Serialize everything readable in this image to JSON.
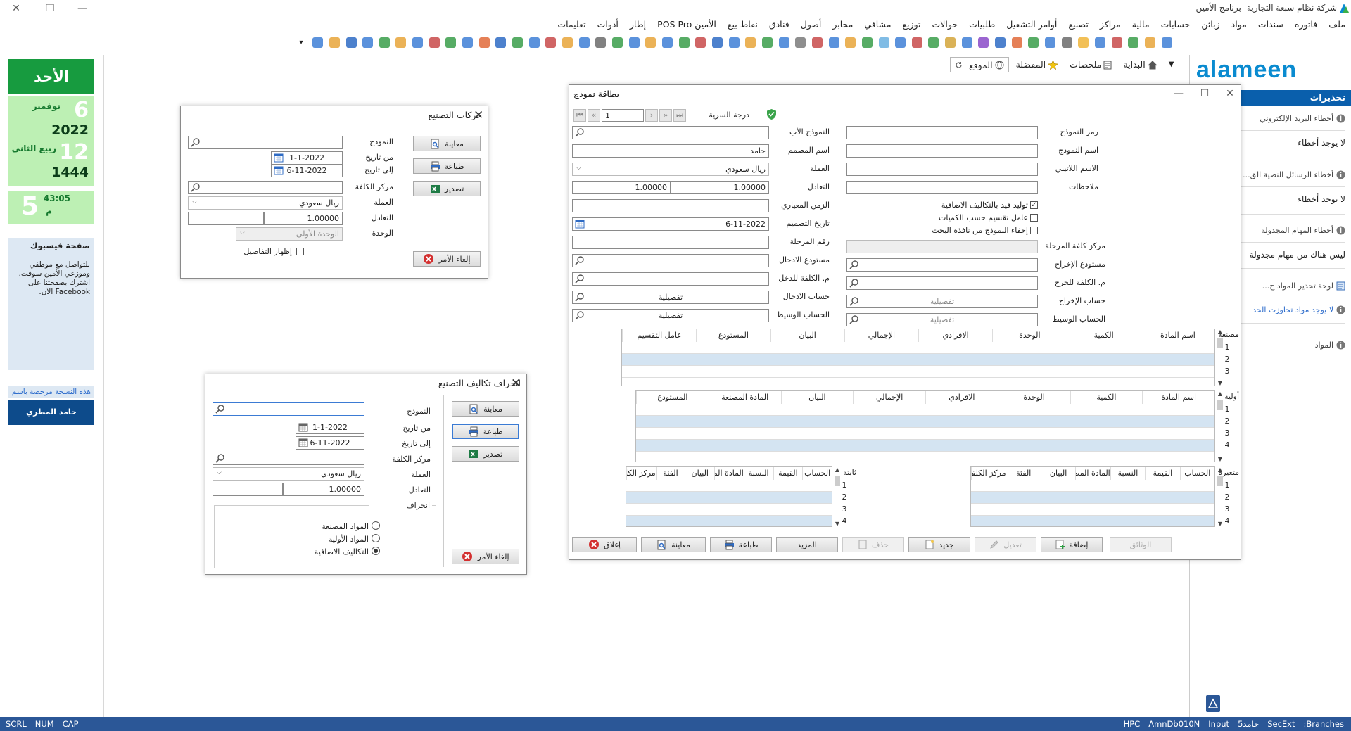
{
  "app": {
    "title": "شركة نظام سبعة التجارية -برنامج الأمين",
    "brand": "alameen"
  },
  "menu": [
    "ملف",
    "فاتورة",
    "سندات",
    "مواد",
    "زبائن",
    "حسابات",
    "مالية",
    "مراكز",
    "تصنيع",
    "أوامر التشغيل",
    "طلبيات",
    "حوالات",
    "توزيع",
    "مشافي",
    "مخابر",
    "أصول",
    "فنادق",
    "نقاط بيع",
    "الأمين POS Pro",
    "إطار",
    "أدوات",
    "تعليمات"
  ],
  "toolbar_icon_colors": [
    "#3e7fd6",
    "#e8a43a",
    "#3a9e4a",
    "#c84a4a",
    "#3e7fd6",
    "#f0b53a",
    "#6b6b6b",
    "#3e7fd6",
    "#3a9e4a",
    "#e06a3a",
    "#2e6bc4",
    "#8a4ac8",
    "#3e7fd6",
    "#d4a43a",
    "#3a9e4a",
    "#c84a4a",
    "#3e7fd6",
    "#6ab0e0",
    "#3a9e4a",
    "#e8a43a",
    "#3e7fd6",
    "#c84a4a",
    "#7a7a7a",
    "#3e7fd6",
    "#3a9e4a",
    "#e8a43a",
    "#3e7fd6",
    "#2e6bc4",
    "#c84a4a",
    "#3a9e4a",
    "#3e7fd6",
    "#e8a43a",
    "#3e7fd6",
    "#3a9e4a",
    "#6b6b6b",
    "#3e7fd6",
    "#e8a43a",
    "#c84a4a",
    "#3e7fd6",
    "#3a9e4a",
    "#2e6bc4",
    "#e06a3a",
    "#3e7fd6",
    "#3a9e4a",
    "#c84a4a",
    "#3e7fd6",
    "#e8a43a",
    "#3a9e4a",
    "#3e7fd6",
    "#2e6bc4",
    "#e8a43a",
    "#3e7fd6"
  ],
  "tabs": {
    "home": "البداية",
    "notes": "ملحصات",
    "fav": "المفضلة",
    "site": "الموقع"
  },
  "calendar": {
    "dayname": "الأحد",
    "day": "6",
    "month": "نوفمبر",
    "year": "2022",
    "hday": "12",
    "hmonth": "ربيع الثاني",
    "hyear": "1444",
    "time": "43:05",
    "hour": "5",
    "ampm": "م"
  },
  "facebook": {
    "title": "صفحة فيسبوك",
    "body": "للتواصل مع موظفي وموزعي الأمين سوفت، اشترك بصفحتنا على Facebook الآن."
  },
  "license": {
    "label": "هذه النسخة مرخصة باسم",
    "owner": "حامد المطري"
  },
  "alerts": {
    "title": "تحذيرات",
    "email_title": "أخطاء البريد الإلكتروني",
    "email_val": "لا يوجد أخطاء",
    "sms_title": "أخطاء الرسائل النصية الق...",
    "sms_val": "لا يوجد أخطاء",
    "tasks_title": "أخطاء المهام المجدولة",
    "tasks_val": "ليس هناك من مهام مجدولة",
    "stock_title": "لوحة تحذير المواد ح...",
    "stock_val": "لا يوجد مواد تجاوزت الحد",
    "items_title": "المواد"
  },
  "w1": {
    "title": "حركات التصنيع",
    "model": "النموذج",
    "from": "من تاريخ",
    "from_val": "1-1-2022",
    "to": "إلى تاريخ",
    "to_val": "6-11-2022",
    "cc": "مركز الكلفة",
    "cur": "العملة",
    "cur_val": "ريال سعودي",
    "rate": "التعادل",
    "rate_val": "1.00000",
    "unit": "الوحدة",
    "unit_val": "الوحدة الأولى",
    "details": "إظهار التفاصيل",
    "preview": "معاينة",
    "print": "طباعة",
    "export": "تصدير",
    "cancel": "إلغاء الأمر"
  },
  "w2": {
    "title": "انحراف تكاليف التصنيع",
    "model": "النموذج",
    "from": "من تاريخ",
    "from_val": "1-1-2022",
    "to": "إلى تاريخ",
    "to_val": "6-11-2022",
    "cc": "مركز الكلفة",
    "cur": "العملة",
    "cur_val": "ريال سعودي",
    "rate": "التعادل",
    "rate_val": "1.00000",
    "dev": "انحراف",
    "opt1": "المواد المصنعة",
    "opt2": "المواد الأولية",
    "opt3": "التكاليف الاضافية",
    "preview": "معاينة",
    "print": "طباعة",
    "export": "تصدير",
    "cancel": "إلغاء الأمر"
  },
  "w3": {
    "title": "بطاقة نموذج",
    "page": "1",
    "secrecy": "درجة السرية",
    "code": "رمز النموذج",
    "name": "اسم النموذج",
    "latin": "الاسم اللاتيني",
    "notes": "ملاحظات",
    "parent": "النموذج الأب",
    "designer": "اسم المصمم",
    "designer_val": "حامد",
    "cur": "العملة",
    "cur_val": "ريال سعودي",
    "rate": "التعادل",
    "rate_val1": "1.00000",
    "rate_val2": "1.00000",
    "stdtime": "الزمن المعياري",
    "ddate": "تاريخ التصميم",
    "ddate_val": "6-11-2022",
    "stage": "رقم المرحلة",
    "chk1": "توليد قيد بالتكاليف الاضافية",
    "chk2": "عامل تقسيم حسب الكميات",
    "chk3": "إخفاء النموذج من نافذة البحث",
    "stagecc": "مركز كلفة المرحلة",
    "inwh": "مستودع الادخال",
    "outwh": "مستودع الإخراج",
    "incc": "م. الكلفة للدخل",
    "outcc": "م. الكلفة للخرج",
    "inacc": "حساب الادخال",
    "outacc": "حساب الإخراج",
    "mid1": "الحساب الوسيط",
    "mid2": "الحساب الوسيط",
    "detail": "تفصيلية",
    "g1": {
      "side": "مصنعة",
      "cols": [
        "اسم المادة",
        "الكمية",
        "الوحدة",
        "الافرادي",
        "الإجمالي",
        "البيان",
        "المستودع",
        "عامل التقسيم"
      ]
    },
    "g2": {
      "side": "أولية",
      "cols": [
        "اسم المادة",
        "الكمية",
        "الوحدة",
        "الافرادي",
        "الإجمالي",
        "البيان",
        "المادة المصنعة",
        "المستودع"
      ]
    },
    "g3": {
      "side": "متغيرة",
      "cols": [
        "الحساب",
        "القيمة",
        "النسبة",
        "المادة المصنعة",
        "البيان",
        "الفئة",
        "مركز الكلفة"
      ]
    },
    "g4": {
      "side": "ثابتة",
      "cols": [
        "الحساب",
        "القيمة",
        "النسبة",
        "المادة المصنعة",
        "البيان",
        "الفئة",
        "مركز الكلفة"
      ]
    },
    "rows": [
      "1",
      "2",
      "3",
      "4"
    ],
    "b_docs": "الوثائق",
    "b_add": "إضافة",
    "b_edit": "تعديل",
    "b_new": "جديد",
    "b_del": "حذف",
    "b_more": "المزيد",
    "b_print": "طباعة",
    "b_preview": "معاينة",
    "b_close": "إغلاق"
  },
  "status": {
    "left": [
      "SCRL",
      "NUM",
      "CAP"
    ],
    "right": [
      "HPC",
      "AmnDb010N",
      "Input",
      "5حامد",
      "SecExt",
      ":Branches"
    ]
  }
}
